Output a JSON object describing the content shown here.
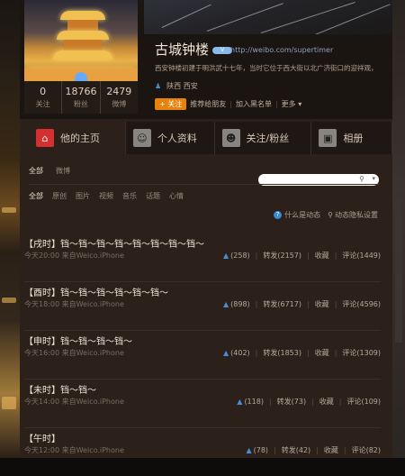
{
  "profile": {
    "name": "古城钟楼",
    "verified_label": "V",
    "url": "http://weibo.com/supertimer",
    "description": "西安钟楼初建于明洪武十七年，当时它位于西大街以北广济街口的迎祥观，",
    "location": "陕西 西安",
    "stats": [
      {
        "num": "0",
        "label": "关注"
      },
      {
        "num": "18766",
        "label": "粉丝"
      },
      {
        "num": "2479",
        "label": "微博"
      }
    ],
    "actions": {
      "follow": "+ 关注",
      "recommend": "推荐给朋友",
      "blacklist": "加入黑名单",
      "more": "更多 ▾"
    }
  },
  "tabs": [
    {
      "label": "他的主页",
      "icon": "home-icon"
    },
    {
      "label": "个人资料",
      "icon": "person-icon"
    },
    {
      "label": "关注/粉丝",
      "icon": "people-icon"
    },
    {
      "label": "相册",
      "icon": "camera-icon"
    }
  ],
  "subtabs": [
    "全部",
    "微博"
  ],
  "filters": [
    "全部",
    "原创",
    "图片",
    "视频",
    "音乐",
    "话题",
    "心情"
  ],
  "help": {
    "what": "什么是动态",
    "privacy": "动态隐私设置"
  },
  "posts": [
    {
      "text": "【戌时】铛～铛～铛～铛～铛～铛～铛～铛～",
      "time": "今天20:00",
      "source": "来自Weico.iPhone",
      "likes": "(258)",
      "repost": "转发(2157)",
      "fav": "收藏",
      "comment": "评论(1449)"
    },
    {
      "text": "【酉时】铛～铛～铛～铛～铛～铛～",
      "time": "今天18:00",
      "source": "来自Weico.iPhone",
      "likes": "(898)",
      "repost": "转发(6717)",
      "fav": "收藏",
      "comment": "评论(4596)"
    },
    {
      "text": "【申时】铛～铛～铛～铛～",
      "time": "今天16:00",
      "source": "来自Weico.iPhone",
      "likes": "(402)",
      "repost": "转发(1853)",
      "fav": "收藏",
      "comment": "评论(1309)"
    },
    {
      "text": "【未时】铛～铛～",
      "time": "今天14:00",
      "source": "来自Weico.iPhone",
      "likes": "(118)",
      "repost": "转发(73)",
      "fav": "收藏",
      "comment": "评论(109)"
    },
    {
      "text": "【午时】",
      "time": "今天12:00",
      "source": "来自Weico.iPhone",
      "likes": "(78)",
      "repost": "转发(42)",
      "fav": "收藏",
      "comment": "评论(82)"
    }
  ]
}
